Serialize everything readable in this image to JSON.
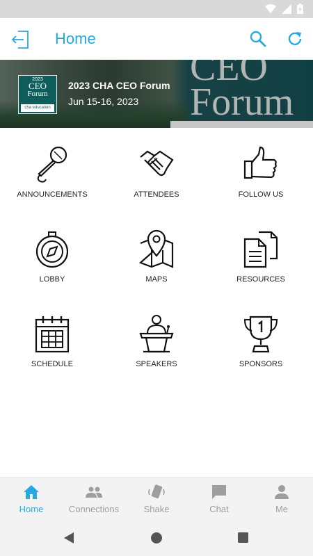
{
  "header": {
    "title": "Home"
  },
  "event": {
    "logo_year": "2023",
    "logo_line1": "CEO",
    "logo_line2": "Forum",
    "logo_org": "cha education",
    "banner_text": "CEO Forum",
    "name": "2023 CHA CEO Forum",
    "dates": "Jun 15-16, 2023"
  },
  "grid": [
    {
      "label": "ANNOUNCEMENTS",
      "icon": "microphone-icon"
    },
    {
      "label": "ATTENDEES",
      "icon": "handshake-icon"
    },
    {
      "label": "FOLLOW US",
      "icon": "thumbs-up-icon"
    },
    {
      "label": "LOBBY",
      "icon": "compass-icon"
    },
    {
      "label": "MAPS",
      "icon": "map-icon"
    },
    {
      "label": "RESOURCES",
      "icon": "documents-icon"
    },
    {
      "label": "SCHEDULE",
      "icon": "calendar-icon"
    },
    {
      "label": "SPEAKERS",
      "icon": "speaker-podium-icon"
    },
    {
      "label": "SPONSORS",
      "icon": "trophy-icon"
    }
  ],
  "tabs": [
    {
      "label": "Home",
      "icon": "home-icon",
      "active": true
    },
    {
      "label": "Connections",
      "icon": "people-icon",
      "active": false
    },
    {
      "label": "Shake",
      "icon": "shake-phone-icon",
      "active": false
    },
    {
      "label": "Chat",
      "icon": "chat-icon",
      "active": false
    },
    {
      "label": "Me",
      "icon": "person-icon",
      "active": false
    }
  ],
  "colors": {
    "accent": "#29a8e0",
    "icon_inactive": "#9e9e9e",
    "logo_bg": "#0f5d5a"
  }
}
